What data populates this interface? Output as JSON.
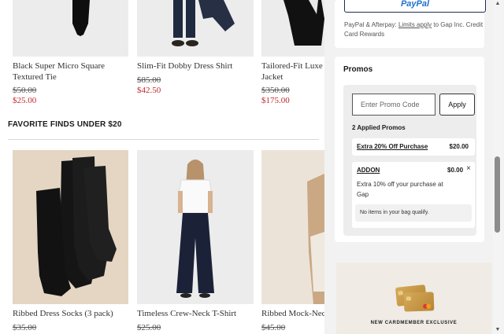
{
  "top_products": [
    {
      "name": "Black Super Micro Square Textured Tie",
      "original_price": "$50.00",
      "sale_price": "$25.00"
    },
    {
      "name": "Slim-Fit Dobby Dress Shirt",
      "original_price": "$85.00",
      "sale_price": "$42.50"
    },
    {
      "name": "Tailored-Fit Luxe Jacket",
      "original_price": "$350.00",
      "sale_price": "$175.00"
    }
  ],
  "section": {
    "title": "FAVORITE FINDS UNDER $20"
  },
  "bottom_products": [
    {
      "name": "Ribbed Dress Socks (3 pack)",
      "original_price": "$35.00"
    },
    {
      "name": "Timeless Crew-Neck T-Shirt",
      "original_price": "$25.00"
    },
    {
      "name": "Ribbed Mock-Neck",
      "original_price": "$45.00"
    }
  ],
  "payment": {
    "paypal_label": "PayPal",
    "note_prefix": "PayPal & Afterpay: ",
    "note_link": "Limits apply",
    "note_suffix": " to Gap Inc. Credit Card Rewards"
  },
  "promos": {
    "title": "Promos",
    "input_placeholder": "Enter Promo Code",
    "apply_label": "Apply",
    "applied_title": "2 Applied Promos",
    "items": [
      {
        "name": "Extra 20% Off Purchase",
        "amount": "$20.00"
      },
      {
        "name": "ADDON",
        "amount": "$0.00",
        "description": "Extra 10% off your purchase at Gap",
        "note": "No items in your bag qualify."
      }
    ],
    "close_icon": "×"
  },
  "card_promo": {
    "text": "NEW CARDMEMBER EXCLUSIVE"
  },
  "icons": [
    "close-icon",
    "scroll-up-icon",
    "scroll-down-icon",
    "credit-card-icon"
  ],
  "colors": {
    "sale_red": "#c1272d",
    "paypal_blue": "#1f6fcf",
    "panel_bg": "#f2f2f2"
  }
}
